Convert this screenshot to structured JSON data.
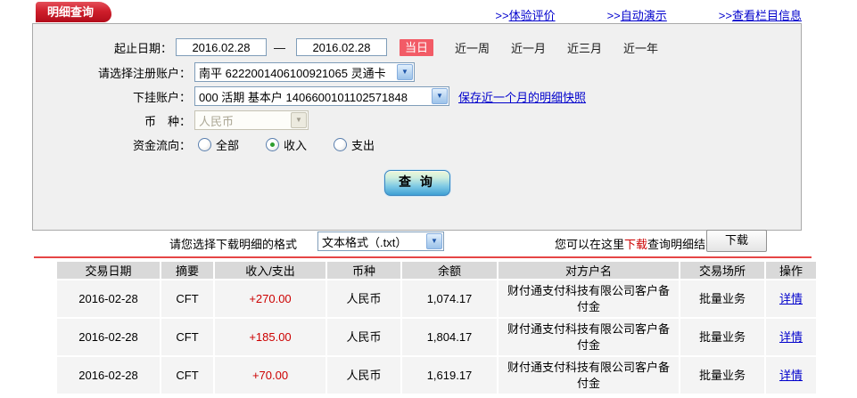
{
  "page": {
    "tab_title": "明细查询",
    "link_prefix": ">>",
    "top_links": [
      {
        "label": "体验评价"
      },
      {
        "label": "自动演示"
      },
      {
        "label": "查看栏目信息"
      }
    ]
  },
  "form": {
    "date_range": {
      "label": "起止日期：",
      "start_value": "2016.02.28",
      "end_value": "2016.02.28",
      "separator": "—",
      "today_button": "当日",
      "quick_ranges": [
        "近一周",
        "近一月",
        "近三月",
        "近一年"
      ]
    },
    "register_account": {
      "label": "请选择注册账户：",
      "value": "南平  6222001406100921065  灵通卡"
    },
    "sub_account": {
      "label": "下挂账户：",
      "value": "000  活期  基本户  1406600101102571848",
      "snapshot_link": "保存近一个月的明细快照"
    },
    "currency": {
      "label": "币　种：",
      "value": "人民币"
    },
    "fund_direction": {
      "label": "资金流向：",
      "options": [
        {
          "label": "全部",
          "selected": false
        },
        {
          "label": "收入",
          "selected": true
        },
        {
          "label": "支出",
          "selected": false
        }
      ]
    },
    "query_button": "查 询"
  },
  "download": {
    "format_label": "请您选择下载明细的格式",
    "format_value": "文本格式（.txt）",
    "hint_prefix": "您可以在这里",
    "hint_highlight": "下载",
    "hint_suffix": "查询明细结果",
    "download_button": "下载"
  },
  "table": {
    "headers": [
      "交易日期",
      "摘要",
      "收入/支出",
      "币种",
      "余额",
      "对方户名",
      "交易场所",
      "操作"
    ],
    "rows": [
      {
        "date": "2016-02-28",
        "summary": "CFT",
        "amount": "+270.00",
        "currency": "人民币",
        "balance": "1,074.17",
        "counterparty": "财付通支付科技有限公司客户备付金",
        "venue": "批量业务",
        "action": "详情"
      },
      {
        "date": "2016-02-28",
        "summary": "CFT",
        "amount": "+185.00",
        "currency": "人民币",
        "balance": "1,804.17",
        "counterparty": "财付通支付科技有限公司客户备付金",
        "venue": "批量业务",
        "action": "详情"
      },
      {
        "date": "2016-02-28",
        "summary": "CFT",
        "amount": "+70.00",
        "currency": "人民币",
        "balance": "1,619.17",
        "counterparty": "财付通支付科技有限公司客户备付金",
        "venue": "批量业务",
        "action": "详情"
      }
    ]
  },
  "colors": {
    "tab_red": "#c1121f",
    "today_button_bg": "#f25b66",
    "link_blue": "#0000cc",
    "amount_red": "#cc0000",
    "table_header_bg": "#d9d9d9",
    "table_row_bg": "#f4f4f4",
    "panel_bg": "#f0f0f0",
    "divider_red": "#e64545"
  }
}
